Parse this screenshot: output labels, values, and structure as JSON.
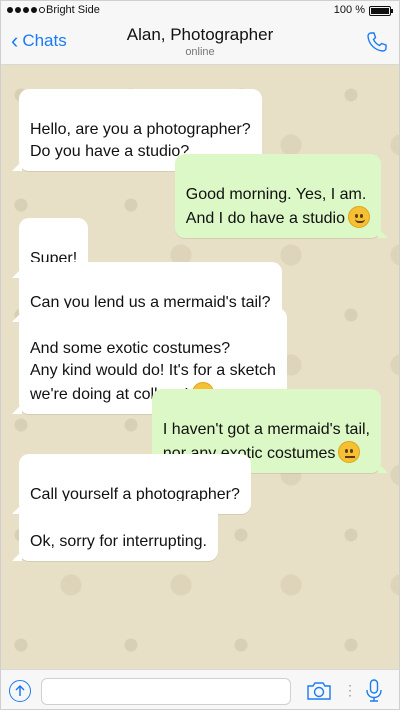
{
  "status_bar": {
    "carrier": "Bright Side",
    "battery": "100 %",
    "signal_bars_filled": 4,
    "signal_bars_total": 5,
    "battery_level": 1.0
  },
  "header": {
    "back_label": "Chats",
    "contact_name": "Alan, Photographer",
    "contact_status": "online"
  },
  "messages": [
    {
      "direction": "incoming",
      "text": "Hello, are you a photographer?\nDo you have a studio?"
    },
    {
      "direction": "outgoing",
      "text": "Good morning. Yes, I am.\nAnd I do have a studio",
      "emoji": "smiling-face"
    },
    {
      "direction": "incoming",
      "text": "Super!"
    },
    {
      "direction": "incoming",
      "text": "Can you lend us a mermaid's tail?"
    },
    {
      "direction": "incoming",
      "text": "And some exotic costumes?\nAny kind would do! It's for a sketch\nwe're doing at college!",
      "emoji": "smiling-face"
    },
    {
      "direction": "outgoing",
      "text": "I haven't got a mermaid's tail,\nnor any exotic costumes",
      "emoji": "neutral-face"
    },
    {
      "direction": "incoming",
      "text": "Call yourself a photographer?"
    },
    {
      "direction": "incoming",
      "text": "Ok, sorry for interrupting."
    }
  ],
  "input": {
    "value": ""
  },
  "colors": {
    "accent": "#1a7cf5",
    "outgoing_bubble": "#dcf8c6",
    "incoming_bubble": "#ffffff",
    "chat_background": "#e7dfc6"
  }
}
